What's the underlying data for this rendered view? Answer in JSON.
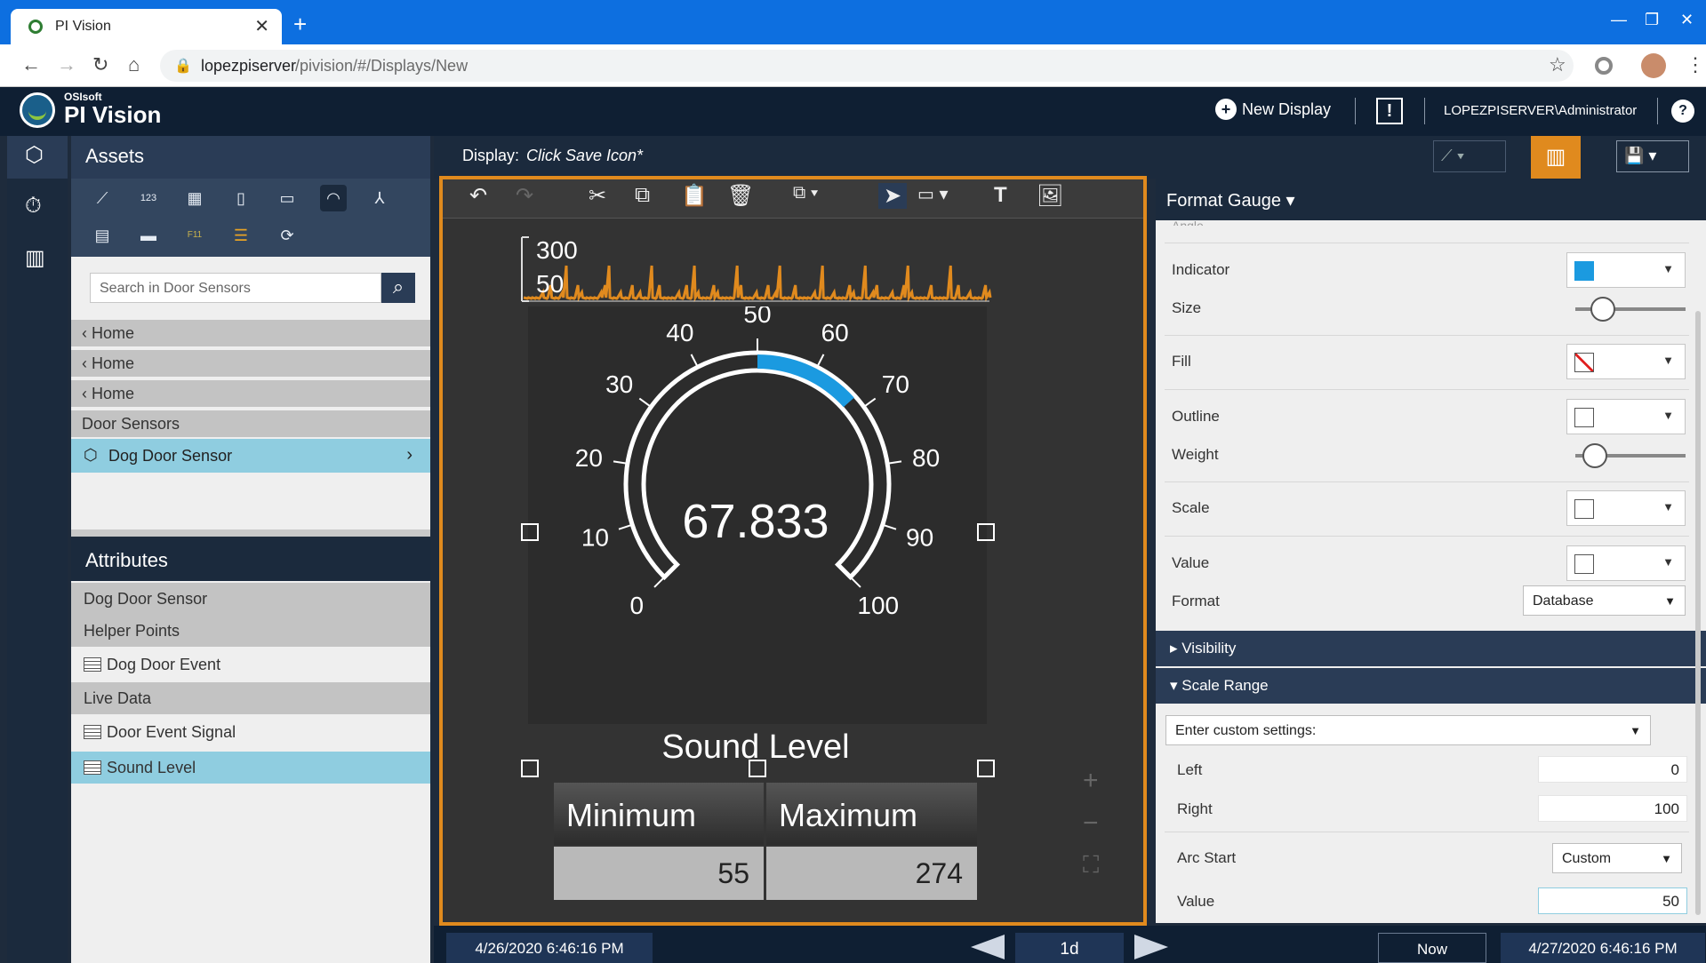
{
  "browser": {
    "tab_title": "PI Vision",
    "url_host": "lopezpiserver",
    "url_path": "/pivision/#/Displays/New"
  },
  "app": {
    "brand_small": "OSIsoft",
    "brand": "PI Vision",
    "new_display": "New Display",
    "user": "LOPEZPISERVER\\Administrator"
  },
  "assets": {
    "title": "Assets",
    "search_placeholder": "Search in Door Sensors",
    "nav": [
      "Home",
      "Home",
      "Home"
    ],
    "folder": "Door Sensors",
    "selected": "Dog Door Sensor"
  },
  "attributes": {
    "title": "Attributes",
    "rows": [
      {
        "label": "Dog Door Sensor",
        "kind": "group"
      },
      {
        "label": "Helper Points",
        "kind": "group"
      },
      {
        "label": "Dog Door Event",
        "kind": "item"
      },
      {
        "label": "Live Data",
        "kind": "group"
      },
      {
        "label": "Door Event Signal",
        "kind": "item"
      },
      {
        "label": "Sound Level",
        "kind": "selected"
      }
    ]
  },
  "display": {
    "label": "Display:",
    "name": "Click Save Icon*"
  },
  "trend": {
    "max_label": "300",
    "min_label": "50"
  },
  "gauge": {
    "value": "67.833",
    "label": "Sound Level",
    "ticks": [
      "0",
      "10",
      "20",
      "30",
      "40",
      "50",
      "60",
      "70",
      "80",
      "90",
      "100"
    ],
    "scale_min": 0,
    "scale_max": 100,
    "arc_start": 50,
    "current": 67.833
  },
  "table": {
    "headers": [
      "Minimum",
      "Maximum"
    ],
    "values": [
      "55",
      "274"
    ]
  },
  "format": {
    "title": "Format Gauge",
    "partial_top": "Angle",
    "indicator": "Indicator",
    "size": "Size",
    "fill": "Fill",
    "outline": "Outline",
    "weight": "Weight",
    "scale": "Scale",
    "value": "Value",
    "format_label": "Format",
    "format_value": "Database",
    "visibility": "Visibility",
    "scale_range": "Scale Range",
    "scale_setting": "Enter custom settings:",
    "left_label": "Left",
    "left_value": "0",
    "right_label": "Right",
    "right_value": "100",
    "arc_start_label": "Arc Start",
    "arc_start_value": "Custom",
    "arc_value_label": "Value",
    "arc_value": "50",
    "indicator_color": "#1b9ae0",
    "size_level": 0.25,
    "weight_level": 0.18
  },
  "timebar": {
    "start": "4/26/2020 6:46:16 PM",
    "duration": "1d",
    "now": "Now",
    "end": "4/27/2020 6:46:16 PM"
  }
}
